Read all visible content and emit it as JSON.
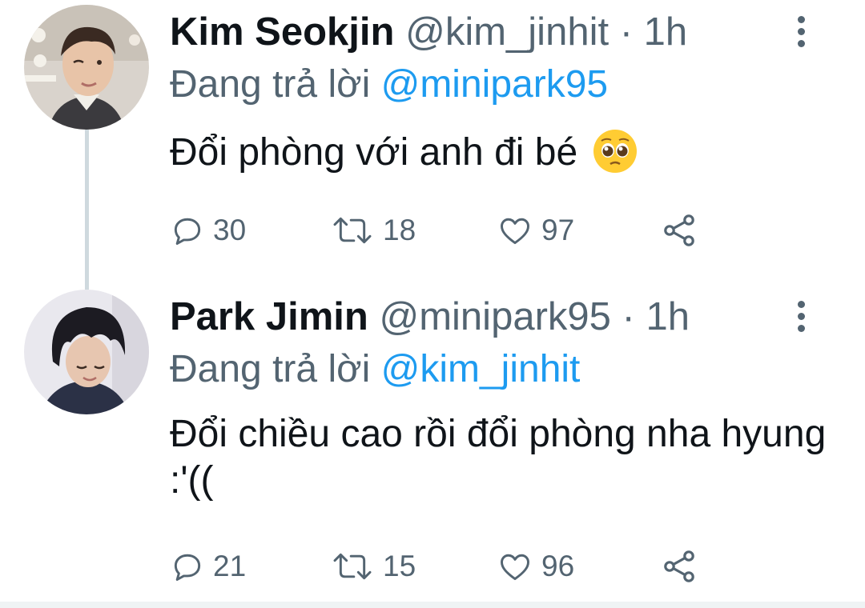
{
  "tweets": [
    {
      "display_name": "Kim Seokjin",
      "handle": "@kim_jinhit",
      "separator": "·",
      "time": "1h",
      "reply_prefix": "Đang trả lời",
      "reply_to": "@minipark95",
      "text": "Đổi phòng với anh đi bé",
      "emoji": "pleading-face-emoji",
      "replies": "30",
      "retweets": "18",
      "likes": "97"
    },
    {
      "display_name": "Park Jimin",
      "handle": "@minipark95",
      "separator": "·",
      "time": "1h",
      "reply_prefix": "Đang trả lời",
      "reply_to": "@kim_jinhit",
      "text": "Đổi chiều cao rồi đổi phòng nha hyung :'((",
      "replies": "21",
      "retweets": "15",
      "likes": "96"
    }
  ],
  "icons": {
    "reply": "reply-icon",
    "retweet": "retweet-icon",
    "like": "heart-icon",
    "share": "share-icon",
    "more": "more-vertical-icon"
  },
  "colors": {
    "text": "#0f1419",
    "secondary": "#536471",
    "link": "#1d9bf0",
    "thread_line": "#cfd9de"
  }
}
